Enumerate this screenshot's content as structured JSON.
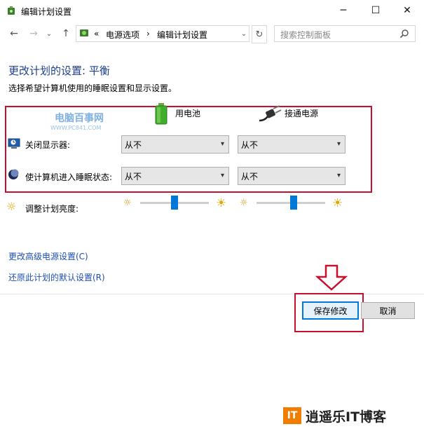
{
  "window": {
    "title": "编辑计划设置",
    "minimize": "─",
    "maximize": "☐",
    "close": "✕"
  },
  "nav": {
    "back": "←",
    "forward": "→",
    "recent": "⌄",
    "up": "↑",
    "breadcrumb_prefix": "«",
    "crumb1": "电源选项",
    "sep": "›",
    "crumb2": "编辑计划设置",
    "dropdown": "⌄",
    "refresh": "↻",
    "search_placeholder": "搜索控制面板"
  },
  "content": {
    "title": "更改计划的设置: 平衡",
    "subtitle": "选择希望计算机使用的睡眠设置和显示设置。",
    "watermark_main": "电脑百事网",
    "watermark_sub": "WWW.PC841.COM",
    "col_battery": "用电池",
    "col_plugged": "接通电源",
    "display_off_label": "关闭显示器:",
    "sleep_label": "使计算机进入睡眠状态:",
    "display_off_battery": "从不",
    "display_off_plugged": "从不",
    "sleep_battery": "从不",
    "sleep_plugged": "从不",
    "brightness_label": "调整计划亮度:",
    "brightness_battery_level": 0.5,
    "brightness_plugged_level": 0.55,
    "advanced_link": "更改高级电源设置(C)",
    "restore_link": "还原此计划的默认设置(R)",
    "save_button": "保存修改",
    "cancel_button": "取消"
  },
  "footer_watermark": {
    "logo": "IT",
    "text": "逍遥乐IT博客"
  },
  "colors": {
    "title_blue": "#1e3f8a",
    "link_blue": "#1e4fb0",
    "highlight_red": "#c8102e",
    "slider_blue": "#0078d7"
  }
}
